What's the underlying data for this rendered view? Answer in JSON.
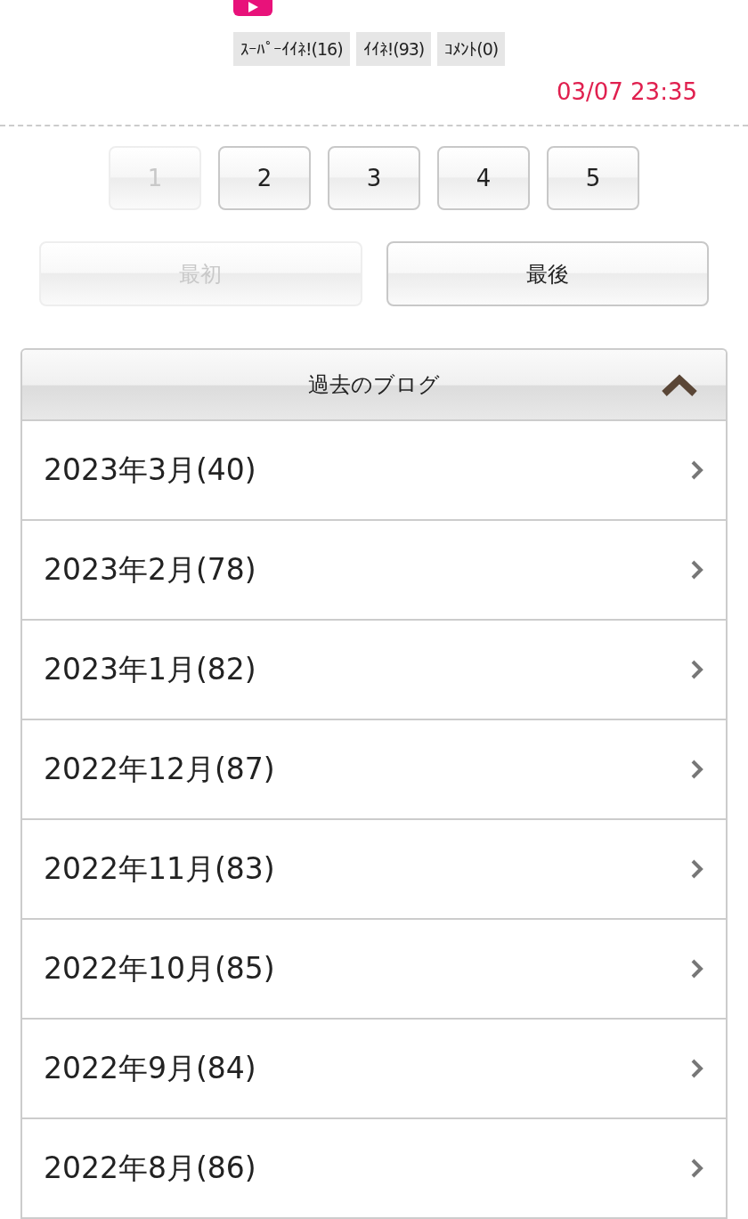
{
  "post": {
    "tags": [
      "ｽｰﾊﾟｰｲｲﾈ!(16)",
      "ｲｲﾈ!(93)",
      "ｺﾒﾝﾄ(0)"
    ],
    "date": "03/07 23:35"
  },
  "pagination": {
    "pages": [
      {
        "label": "1",
        "selected": true
      },
      {
        "label": "2",
        "selected": false
      },
      {
        "label": "3",
        "selected": false
      },
      {
        "label": "4",
        "selected": false
      },
      {
        "label": "5",
        "selected": false
      }
    ],
    "first": {
      "label": "最初",
      "disabled": true
    },
    "last": {
      "label": "最後",
      "disabled": false
    }
  },
  "archive": {
    "title": "過去のブログ",
    "expanded": true,
    "items": [
      "2023年3月(40)",
      "2023年2月(78)",
      "2023年1月(82)",
      "2022年12月(87)",
      "2022年11月(83)",
      "2022年10月(85)",
      "2022年9月(84)",
      "2022年8月(86)"
    ]
  }
}
